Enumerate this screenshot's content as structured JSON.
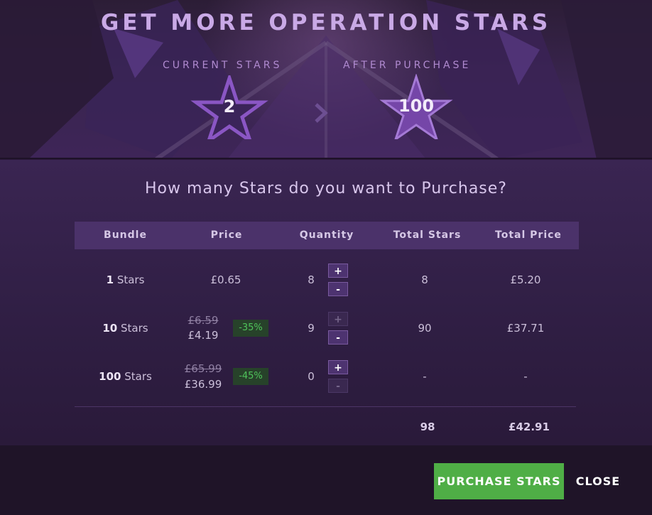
{
  "header": {
    "title": "GET MORE OPERATION STARS",
    "current_label": "CURRENT STARS",
    "after_label": "AFTER PURCHASE",
    "current_stars": "2",
    "after_stars": "100"
  },
  "question": "How many Stars do you want to Purchase?",
  "table": {
    "columns": [
      "Bundle",
      "Price",
      "Quantity",
      "Total Stars",
      "Total Price"
    ],
    "rows": [
      {
        "bundle_count": "1",
        "bundle_unit": "Stars",
        "price": "£0.65",
        "original_price": "",
        "discount": "",
        "quantity": "8",
        "plus": "+",
        "minus": "-",
        "total_stars": "8",
        "total_price": "£5.20"
      },
      {
        "bundle_count": "10",
        "bundle_unit": "Stars",
        "price": "£4.19",
        "original_price": "£6.59",
        "discount": "-35%",
        "quantity": "9",
        "plus": "+",
        "minus": "-",
        "total_stars": "90",
        "total_price": "£37.71"
      },
      {
        "bundle_count": "100",
        "bundle_unit": "Stars",
        "price": "£36.99",
        "original_price": "£65.99",
        "discount": "-45%",
        "quantity": "0",
        "plus": "+",
        "minus": "-",
        "total_stars": "-",
        "total_price": "-"
      }
    ],
    "totals": {
      "stars": "98",
      "price": "£42.91"
    }
  },
  "buttons": {
    "purchase": "PURCHASE STARS",
    "close": "CLOSE"
  },
  "colors": {
    "accent_purple": "#7a4fb0",
    "purchase_green": "#4fae46",
    "discount_green": "#4fc35b"
  }
}
